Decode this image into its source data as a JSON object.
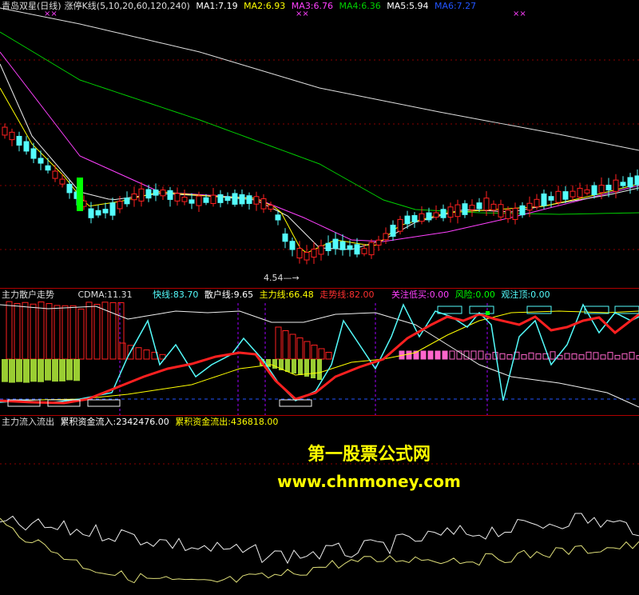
{
  "colors": {
    "white": "#ffffff",
    "yellow": "#ffff00",
    "magenta": "#ff40ff",
    "green": "#00d000",
    "blue": "#2255ff",
    "cyan": "#54fcfc",
    "red": "#ff2020",
    "pink": "#ff66cc",
    "lime": "#00ff00",
    "grid": "#8a0000",
    "violet": "#a000ff",
    "orange": "#ff9000"
  },
  "panel1": {
    "stock": "青岛双星(日线)",
    "indicator": "涨停K线(5,10,20,60,120,240)",
    "ma": [
      {
        "label": "MA1:7.19",
        "color": "#ffffff"
      },
      {
        "label": "MA2:6.93",
        "color": "#ffff00"
      },
      {
        "label": "MA3:6.76",
        "color": "#ff40ff"
      },
      {
        "label": "MA4:6.36",
        "color": "#00d000"
      },
      {
        "label": "MA5:5.94",
        "color": "#ffffff"
      },
      {
        "label": "MA6:7.27",
        "color": "#2255ff"
      }
    ],
    "low_marker": "4.54",
    "top_marks": [
      "××",
      "××",
      "××"
    ]
  },
  "panel2": {
    "title": "主力散户走势",
    "items": [
      {
        "label": "CDMA:11.31",
        "color": "#dddddd"
      },
      {
        "label": "快线:83.70",
        "color": "#54fcfc"
      },
      {
        "label": "散户线:9.65",
        "color": "#ffffff"
      },
      {
        "label": "主力线:66.48",
        "color": "#ffff00"
      },
      {
        "label": "走势线:82.00",
        "color": "#ff3030"
      },
      {
        "label": "关注低买:0.00",
        "color": "#ff40ff"
      },
      {
        "label": "风险:0.00",
        "color": "#00ff00"
      },
      {
        "label": "观注顶:0.00",
        "color": "#54fcfc"
      }
    ]
  },
  "panel3": {
    "title": "主力流入流出",
    "inflow": "累积资金流入:2342476.00",
    "outflow": "累积资金流出:436818.00",
    "watermark_cn": "第一股票公式网",
    "watermark_url": "www.chnmoney.com"
  }
}
